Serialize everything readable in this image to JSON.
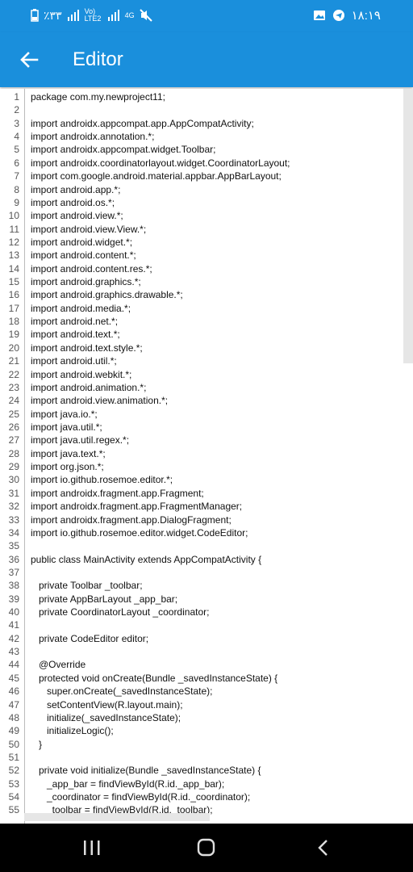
{
  "status_bar": {
    "left_text": "٪۳۳",
    "network": "Vo) LTE2",
    "network2": "4G",
    "time": "۱۸:۱۹"
  },
  "app_bar": {
    "title": "Editor",
    "back_icon": "arrow-left-icon"
  },
  "editor": {
    "lines": [
      {
        "n": "1",
        "t": "package com.my.newproject11;"
      },
      {
        "n": "2",
        "t": ""
      },
      {
        "n": "3",
        "t": "import androidx.appcompat.app.AppCompatActivity;"
      },
      {
        "n": "4",
        "t": "import androidx.annotation.*;"
      },
      {
        "n": "5",
        "t": "import androidx.appcompat.widget.Toolbar;"
      },
      {
        "n": "6",
        "t": "import androidx.coordinatorlayout.widget.CoordinatorLayout;"
      },
      {
        "n": "7",
        "t": "import com.google.android.material.appbar.AppBarLayout;"
      },
      {
        "n": "8",
        "t": "import android.app.*;"
      },
      {
        "n": "9",
        "t": "import android.os.*;"
      },
      {
        "n": "10",
        "t": "import android.view.*;"
      },
      {
        "n": "11",
        "t": "import android.view.View.*;"
      },
      {
        "n": "12",
        "t": "import android.widget.*;"
      },
      {
        "n": "13",
        "t": "import android.content.*;"
      },
      {
        "n": "14",
        "t": "import android.content.res.*;"
      },
      {
        "n": "15",
        "t": "import android.graphics.*;"
      },
      {
        "n": "16",
        "t": "import android.graphics.drawable.*;"
      },
      {
        "n": "17",
        "t": "import android.media.*;"
      },
      {
        "n": "18",
        "t": "import android.net.*;"
      },
      {
        "n": "19",
        "t": "import android.text.*;"
      },
      {
        "n": "20",
        "t": "import android.text.style.*;"
      },
      {
        "n": "21",
        "t": "import android.util.*;"
      },
      {
        "n": "22",
        "t": "import android.webkit.*;"
      },
      {
        "n": "23",
        "t": "import android.animation.*;"
      },
      {
        "n": "24",
        "t": "import android.view.animation.*;"
      },
      {
        "n": "25",
        "t": "import java.io.*;"
      },
      {
        "n": "26",
        "t": "import java.util.*;"
      },
      {
        "n": "27",
        "t": "import java.util.regex.*;"
      },
      {
        "n": "28",
        "t": "import java.text.*;"
      },
      {
        "n": "29",
        "t": "import org.json.*;"
      },
      {
        "n": "30",
        "t": "import io.github.rosemoe.editor.*;"
      },
      {
        "n": "31",
        "t": "import androidx.fragment.app.Fragment;"
      },
      {
        "n": "32",
        "t": "import androidx.fragment.app.FragmentManager;"
      },
      {
        "n": "33",
        "t": "import androidx.fragment.app.DialogFragment;"
      },
      {
        "n": "34",
        "t": "import io.github.rosemoe.editor.widget.CodeEditor;"
      },
      {
        "n": "35",
        "t": ""
      },
      {
        "n": "36",
        "t": "public class MainActivity extends AppCompatActivity {"
      },
      {
        "n": "37",
        "t": ""
      },
      {
        "n": "38",
        "t": "   private Toolbar _toolbar;"
      },
      {
        "n": "39",
        "t": "   private AppBarLayout _app_bar;"
      },
      {
        "n": "40",
        "t": "   private CoordinatorLayout _coordinator;"
      },
      {
        "n": "41",
        "t": ""
      },
      {
        "n": "42",
        "t": "   private CodeEditor editor;"
      },
      {
        "n": "43",
        "t": ""
      },
      {
        "n": "44",
        "t": "   @Override"
      },
      {
        "n": "45",
        "t": "   protected void onCreate(Bundle _savedInstanceState) {"
      },
      {
        "n": "46",
        "t": "      super.onCreate(_savedInstanceState);"
      },
      {
        "n": "47",
        "t": "      setContentView(R.layout.main);"
      },
      {
        "n": "48",
        "t": "      initialize(_savedInstanceState);"
      },
      {
        "n": "49",
        "t": "      initializeLogic();"
      },
      {
        "n": "50",
        "t": "   }"
      },
      {
        "n": "51",
        "t": ""
      },
      {
        "n": "52",
        "t": "   private void initialize(Bundle _savedInstanceState) {"
      },
      {
        "n": "53",
        "t": "      _app_bar = findViewById(R.id._app_bar);"
      },
      {
        "n": "54",
        "t": "      _coordinator = findViewById(R.id._coordinator);"
      },
      {
        "n": "55",
        "t": "      _toolbar = findViewById(R.id._toolbar);"
      }
    ]
  },
  "nav_bar": {
    "recents_icon": "recents-icon",
    "home_icon": "home-icon",
    "back_icon": "back-triangle-icon"
  }
}
